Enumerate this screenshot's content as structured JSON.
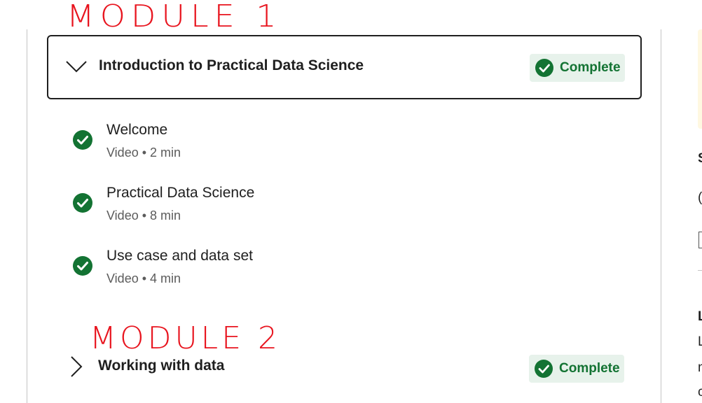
{
  "annotations": {
    "module1": "MODULE 1",
    "module2": "MODULE 2"
  },
  "colors": {
    "annotation": "#e8141e",
    "complete_green": "#137333",
    "complete_bg": "#e7f2eb",
    "border": "#1f1f1f"
  },
  "modules": [
    {
      "title": "Introduction to Practical Data Science",
      "status": "Complete",
      "expanded": true,
      "toggle_icon": "chevron-down-icon",
      "items": [
        {
          "title": "Welcome",
          "meta": "Video • 2 min",
          "icon": "check-circle-icon"
        },
        {
          "title": "Practical Data Science",
          "meta": "Video • 8 min",
          "icon": "check-circle-icon"
        },
        {
          "title": "Use case and data set",
          "meta": "Video • 4 min",
          "icon": "check-circle-icon"
        }
      ]
    },
    {
      "title": "Working with data",
      "status": "Complete",
      "expanded": false,
      "toggle_icon": "chevron-right-icon"
    }
  ],
  "right_panel": {
    "fragment_1": "S",
    "fragment_2": "(",
    "fragment_3": "L",
    "fragment_4": "L",
    "fragment_5": "n",
    "fragment_6": "c"
  }
}
